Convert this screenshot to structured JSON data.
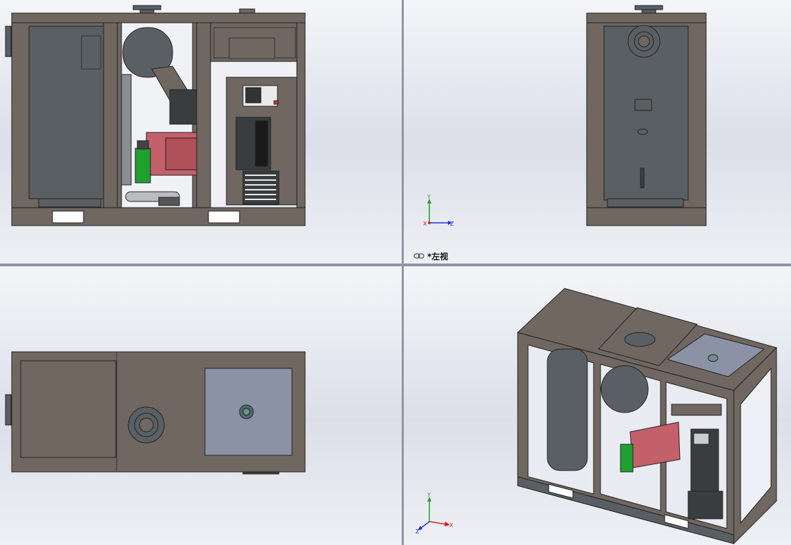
{
  "viewports": {
    "front": {
      "name": "front-view"
    },
    "left": {
      "name": "left-view",
      "label": "*左视"
    },
    "top": {
      "name": "top-view"
    },
    "iso": {
      "name": "isometric-view"
    }
  },
  "triad": {
    "left_view": {
      "y": "Y",
      "z": "Z",
      "x": "X"
    },
    "iso_view": {
      "y": "Y",
      "x": "X",
      "z": "Z"
    }
  },
  "colors": {
    "frame": "#6f6760",
    "panel": "#5a5f63",
    "motor": "#c4606a",
    "filter": "#1fa030",
    "top_plate": "#8c92a6",
    "axis_x": "#d02020",
    "axis_y": "#20a020",
    "axis_z": "#2030d0"
  }
}
